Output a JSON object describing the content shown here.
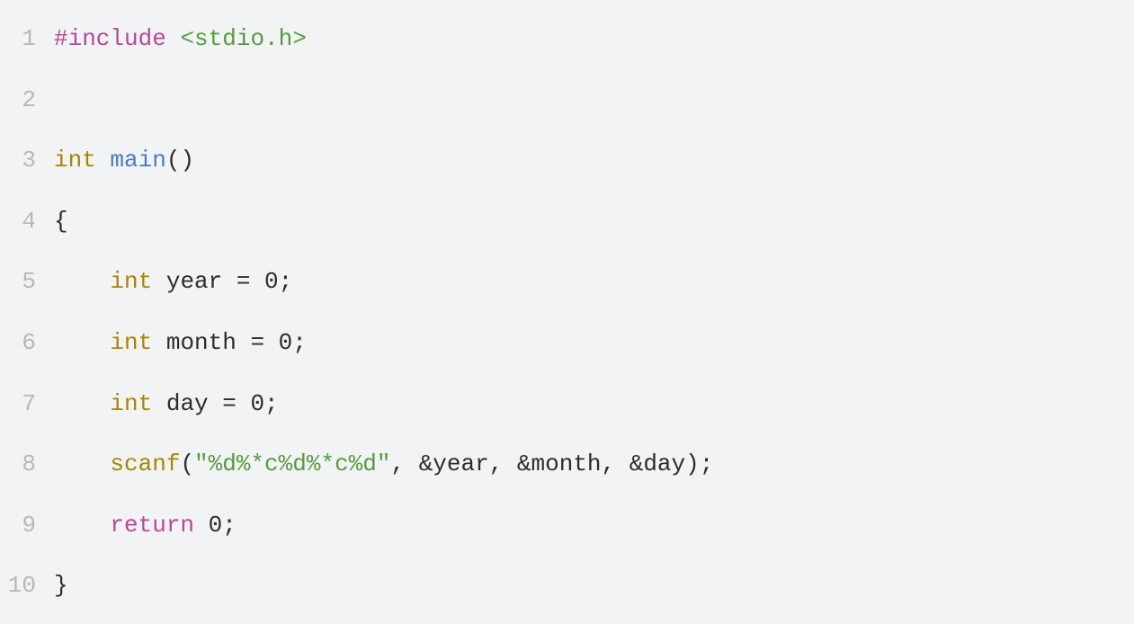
{
  "lines": [
    {
      "num": "1"
    },
    {
      "num": "2"
    },
    {
      "num": "3"
    },
    {
      "num": "4"
    },
    {
      "num": "5"
    },
    {
      "num": "6"
    },
    {
      "num": "7"
    },
    {
      "num": "8"
    },
    {
      "num": "9"
    },
    {
      "num": "10"
    }
  ],
  "tokens": {
    "l1_preproc": "#include",
    "l1_space": " ",
    "l1_path": "<stdio.h>",
    "l2_empty": "",
    "l3_kw": "int",
    "l3_space": " ",
    "l3_fn": "main",
    "l3_parens": "()",
    "l4_brace": "{",
    "l5_indent": "    ",
    "l5_kw": "int",
    "l5_rest": " year = 0;",
    "l6_indent": "    ",
    "l6_kw": "int",
    "l6_rest": " month = 0;",
    "l7_indent": "    ",
    "l7_kw": "int",
    "l7_rest": " day = 0;",
    "l8_indent": "    ",
    "l8_fn": "scanf",
    "l8_open": "(",
    "l8_str": "\"%d%*c%d%*c%d\"",
    "l8_rest": ", &year, &month, &day);",
    "l9_indent": "    ",
    "l9_ret": "return",
    "l9_rest": " 0;",
    "l10_brace": "}"
  }
}
